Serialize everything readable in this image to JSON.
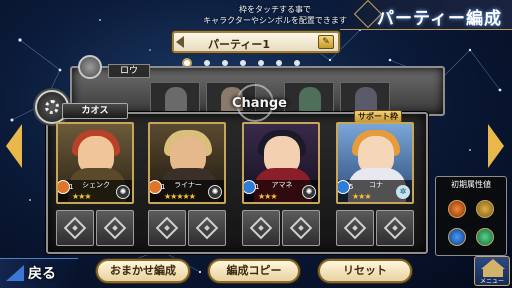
{
  "screen": {
    "title": "パーティー編成",
    "instruction_line1": "枠をタッチする事で",
    "instruction_line2": "キャラクターやシンボルを配置できます"
  },
  "party": {
    "name": "パーティー1",
    "edit_icon": "edit-pencil-icon",
    "page_count": 7,
    "active_page": 1
  },
  "back_row": {
    "label": "ロウ"
  },
  "main_row": {
    "label": "カオス",
    "change_label": "Change",
    "support_label": "サポート枠"
  },
  "characters": [
    {
      "level": "Lv1",
      "name": "シェンク",
      "stars": "★★★",
      "element": "fire",
      "badge": "chaos"
    },
    {
      "level": "Lv1",
      "name": "ライナー",
      "stars": "★★★★★",
      "element": "fire",
      "badge": "chaos"
    },
    {
      "level": "Lv1",
      "name": "アマネ",
      "stars": "★★★",
      "element": "water",
      "badge": "chaos"
    },
    {
      "level": "Lv5",
      "name": "コナ",
      "stars": "★★★",
      "element": "water",
      "badge": "neutral"
    }
  ],
  "attribute_panel": {
    "title": "初期属性値",
    "options": [
      "fire",
      "earth",
      "water",
      "wind"
    ]
  },
  "buttons": {
    "back": "戻る",
    "auto_form": "おまかせ編成",
    "copy_form": "編成コピー",
    "reset": "リセット",
    "menu": "メニュー"
  },
  "colors": {
    "gold_frame": "#c7a65a",
    "fire": "#e0742b",
    "water": "#2f7bd8",
    "nav_arrow": "#e8b84a"
  }
}
